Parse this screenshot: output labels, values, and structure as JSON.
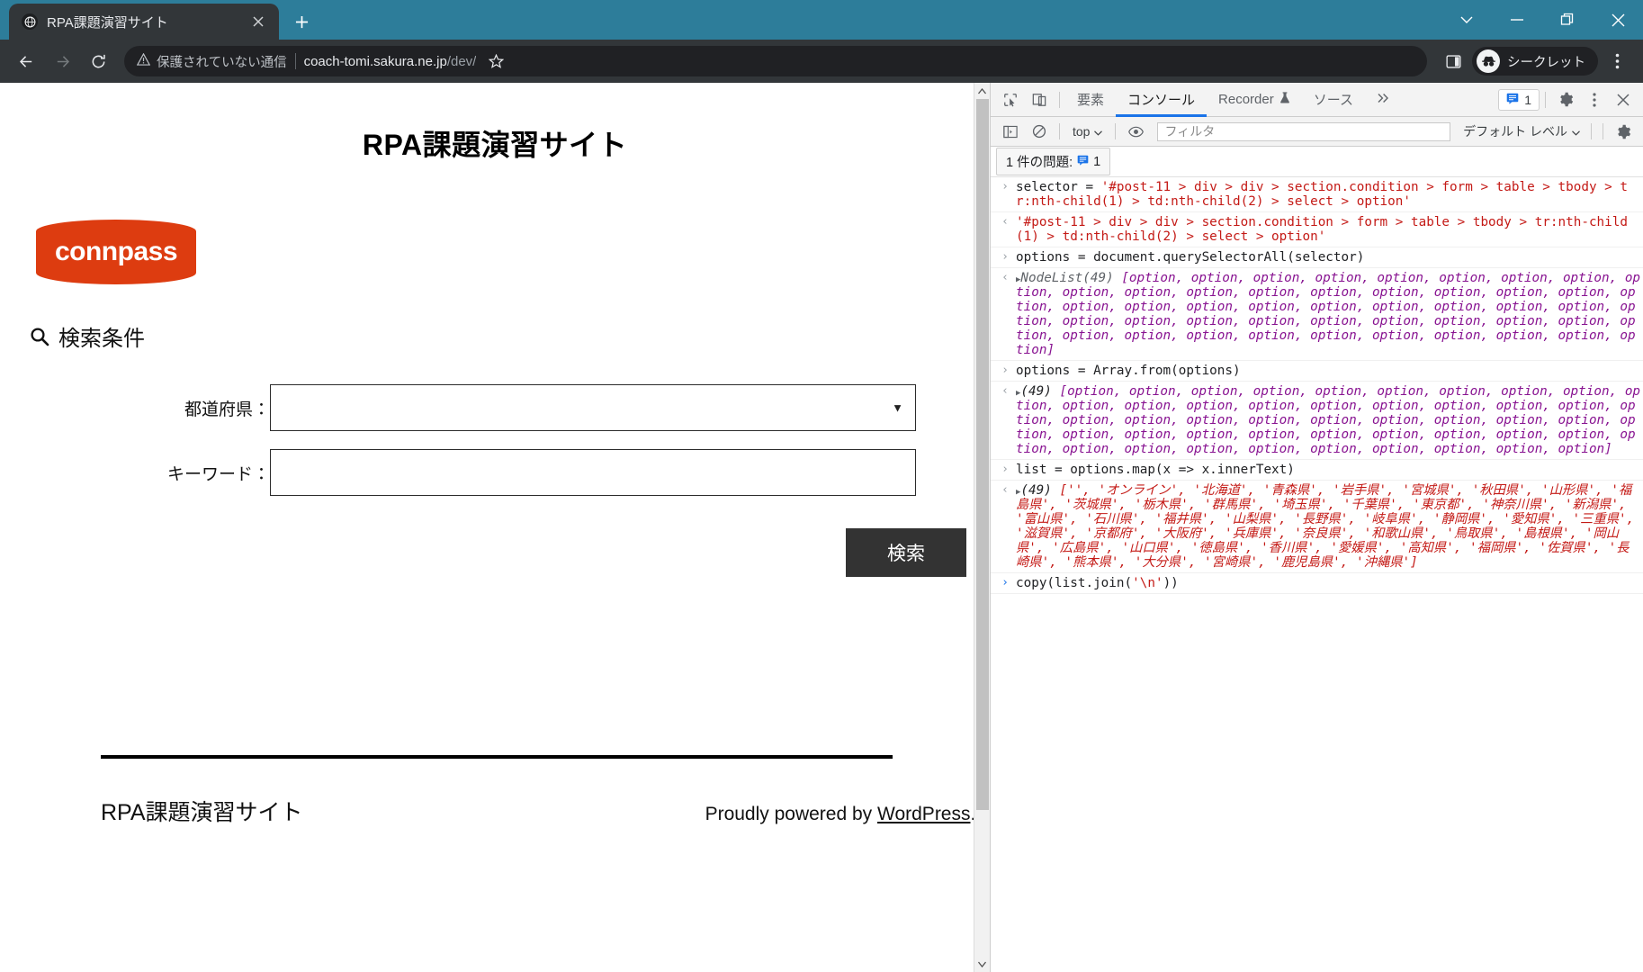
{
  "browser": {
    "tab": {
      "title": "RPA課題演習サイト",
      "favicon_icon": "globe-icon",
      "close_icon": "close-icon"
    },
    "new_tab_label": "+",
    "window_controls": {
      "minimize": "minimize-icon",
      "maximize": "maximize-icon",
      "close": "close-icon",
      "expand": "chevron-down-icon"
    },
    "toolbar": {
      "back_icon": "arrow-left-icon",
      "forward_icon": "arrow-right-icon",
      "reload_icon": "reload-icon",
      "security_warning": "保護されていない通信",
      "url_host": "coach-tomi.sakura.ne.jp",
      "url_path": "/dev/",
      "bookmark_icon": "star-icon",
      "sidepanel_icon": "side-panel-icon",
      "incognito_label": "シークレット",
      "menu_icon": "three-dot-menu-icon"
    }
  },
  "page": {
    "site_title": "RPA課題演習サイト",
    "logo_text": "connpass",
    "logo_color": "#dd3c10",
    "section_heading": "検索条件",
    "search_icon": "magnifier-icon",
    "form": {
      "pref_label": "都道府県：",
      "pref_value": "",
      "pref_arrow_icon": "chevron-down-icon",
      "pref_options": [
        "",
        "オンライン",
        "北海道",
        "青森県",
        "岩手県",
        "宮城県",
        "秋田県",
        "山形県",
        "福島県",
        "茨城県",
        "栃木県",
        "群馬県",
        "埼玉県",
        "千葉県",
        "東京都",
        "神奈川県",
        "新潟県",
        "富山県",
        "石川県",
        "福井県",
        "山梨県",
        "長野県",
        "岐阜県",
        "静岡県",
        "愛知県",
        "三重県",
        "滋賀県",
        "京都府",
        "大阪府",
        "兵庫県",
        "奈良県",
        "和歌山県",
        "鳥取県",
        "島根県",
        "岡山県",
        "広島県",
        "山口県",
        "徳島県",
        "香川県",
        "愛媛県",
        "高知県",
        "福岡県",
        "佐賀県",
        "長崎県",
        "熊本県",
        "大分県",
        "宮崎県",
        "鹿児島県",
        "沖縄県"
      ],
      "keyword_label": "キーワード：",
      "keyword_value": "",
      "keyword_placeholder": "",
      "submit_label": "検索"
    },
    "footer": {
      "site_name": "RPA課題演習サイト",
      "powered_prefix": "Proudly powered by ",
      "powered_link": "WordPress",
      "powered_suffix": "."
    }
  },
  "devtools": {
    "inspect_icon": "inspect-element-icon",
    "device_icon": "device-toolbar-icon",
    "tabs": [
      {
        "label": "要素",
        "active": false
      },
      {
        "label": "コンソール",
        "active": true
      },
      {
        "label": "Recorder",
        "active": false,
        "icon": "flask-icon"
      },
      {
        "label": "ソース",
        "active": false
      }
    ],
    "overflow_icon": "chevron-right-double-icon",
    "issues_badge": {
      "icon": "message-icon",
      "count": "1"
    },
    "settings_icon": "gear-icon",
    "menu_icon": "three-dot-menu-icon",
    "close_icon": "close-icon",
    "filterbar": {
      "sidebar_icon": "console-sidebar-icon",
      "clear_icon": "clear-console-icon",
      "context": "top",
      "context_arrow": "chevron-down-icon",
      "eye_icon": "live-expression-icon",
      "filter_placeholder": "フィルタ",
      "filter_value": "",
      "level": "デフォルト レベル",
      "level_arrow": "chevron-down-icon",
      "settings_icon": "gear-icon"
    },
    "issue_bar": {
      "label": "1 件の問題:",
      "icon": "message-icon",
      "count": "1"
    },
    "console_rows": [
      {
        "kind": "input",
        "gutter": "›",
        "text": "selector = '#post-11 > div > div > section.condition > form > table > tbody > tr:nth-child(1) > td:nth-child(2) > select > option'"
      },
      {
        "kind": "echo",
        "gutter": "‹",
        "text": "'#post-11 > div > div > section.condition > form > table > tbody > tr:nth-child(1) > td:nth-child(2) > select > option'"
      },
      {
        "kind": "input",
        "gutter": "›",
        "text": "options = document.querySelectorAll(selector)"
      },
      {
        "kind": "result-nodelist",
        "gutter": "‹",
        "prefix": "NodeList(49) ",
        "count": 49,
        "item": "option"
      },
      {
        "kind": "input",
        "gutter": "›",
        "text": "options = Array.from(options)"
      },
      {
        "kind": "result-array",
        "gutter": "‹",
        "prefix": "(49) ",
        "count": 49,
        "item": "option"
      },
      {
        "kind": "input",
        "gutter": "›",
        "text": "list = options.map(x => x.innerText)"
      },
      {
        "kind": "result-strings",
        "gutter": "‹",
        "prefix": "(49) ",
        "values": [
          "",
          "オンライン",
          "北海道",
          "青森県",
          "岩手県",
          "宮城県",
          "秋田県",
          "山形県",
          "福島県",
          "茨城県",
          "栃木県",
          "群馬県",
          "埼玉県",
          "千葉県",
          "東京都",
          "神奈川県",
          "新潟県",
          "富山県",
          "石川県",
          "福井県",
          "山梨県",
          "長野県",
          "岐阜県",
          "静岡県",
          "愛知県",
          "三重県",
          "滋賀県",
          "京都府",
          "大阪府",
          "兵庫県",
          "奈良県",
          "和歌山県",
          "鳥取県",
          "島根県",
          "岡山県",
          "広島県",
          "山口県",
          "徳島県",
          "香川県",
          "愛媛県",
          "高知県",
          "福岡県",
          "佐賀県",
          "長崎県",
          "熊本県",
          "大分県",
          "宮崎県",
          "鹿児島県",
          "沖縄県"
        ]
      },
      {
        "kind": "input-blue",
        "gutter": "›",
        "text": "copy(list.join('\\n'))"
      }
    ]
  }
}
